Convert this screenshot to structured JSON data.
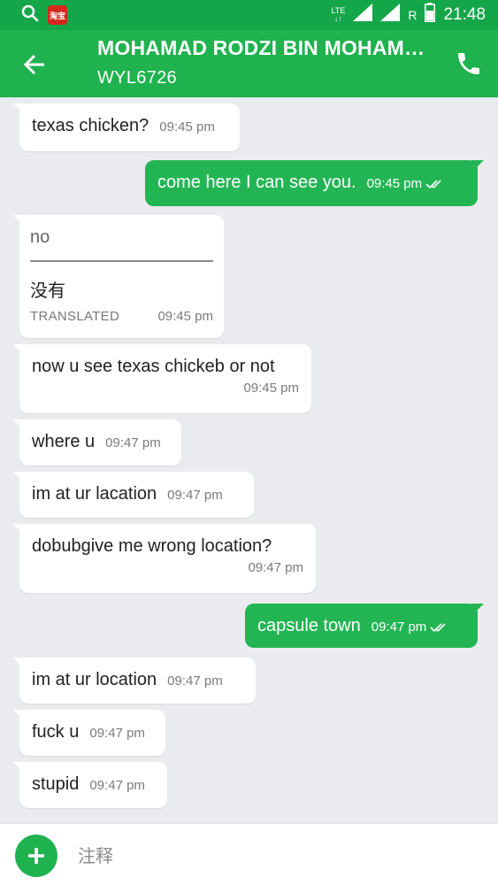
{
  "status_bar": {
    "network": "LTE",
    "roaming": "R",
    "time": "21:48",
    "app_badge": "淘宝"
  },
  "header": {
    "title": "MOHAMAD RODZI BIN MOHAM…",
    "subtitle": "WYL6726"
  },
  "messages": [
    {
      "dir": "in",
      "text": "texas chicken?",
      "time": "09:45 pm"
    },
    {
      "dir": "out",
      "text": "come here I can see you.",
      "time": "09:45 pm"
    },
    {
      "dir": "in",
      "original": "no",
      "translated": "没有",
      "translated_label": "TRANSLATED",
      "time": "09:45 pm"
    },
    {
      "dir": "in",
      "text": "now u see texas chickeb or not",
      "time": "09:45 pm"
    },
    {
      "dir": "in",
      "text": "where u",
      "time": "09:47 pm"
    },
    {
      "dir": "in",
      "text": "im at ur lacation",
      "time": "09:47 pm"
    },
    {
      "dir": "in",
      "text": "dobubgive me wrong location?",
      "time": "09:47 pm"
    },
    {
      "dir": "out",
      "text": "capsule town",
      "time": "09:47 pm"
    },
    {
      "dir": "in",
      "text": "im at ur location",
      "time": "09:47 pm"
    },
    {
      "dir": "in",
      "text": "fuck u",
      "time": "09:47 pm"
    },
    {
      "dir": "in",
      "text": "stupid",
      "time": "09:47 pm"
    }
  ],
  "composer": {
    "placeholder": "注释"
  },
  "colors": {
    "header": "#1fb24e",
    "status_bar": "#16a64a",
    "outgoing_bubble": "#23b554",
    "background": "#e9ebee"
  }
}
